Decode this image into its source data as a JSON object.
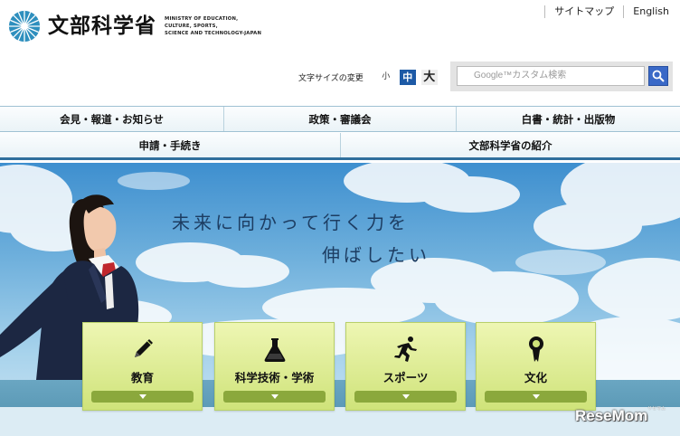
{
  "header": {
    "logo_jp": "文部科学省",
    "logo_en": [
      "MINISTRY OF EDUCATION,",
      "CULTURE, SPORTS,",
      "SCIENCE AND TECHNOLOGY-JAPAN"
    ],
    "top_links": [
      "サイトマップ",
      "English"
    ]
  },
  "font_size": {
    "label": "文字サイズの変更",
    "small": "小",
    "medium": "中",
    "large": "大",
    "selected": "中"
  },
  "search": {
    "placeholder": "Google™カスタム検索"
  },
  "nav": {
    "row1": [
      "会見・報道・お知らせ",
      "政策・審議会",
      "白書・統計・出版物"
    ],
    "row2": [
      "申請・手続き",
      "文部科学省の紹介"
    ]
  },
  "hero": {
    "tagline_line1": "未来に向かって行く力を",
    "tagline_line2": "伸ばしたい"
  },
  "categories": [
    {
      "label": "教育",
      "icon": "pencil-icon"
    },
    {
      "label": "科学技術・学術",
      "icon": "flask-icon"
    },
    {
      "label": "スポーツ",
      "icon": "runner-icon"
    },
    {
      "label": "文化",
      "icon": "medal-icon"
    }
  ],
  "watermark": {
    "text": "ReseMom",
    "sub": "リセマム"
  },
  "colors": {
    "nav_border": "#2f6f9c",
    "selected_fontsize": "#1d5aa6",
    "search_button": "#3a69c7",
    "category_bg": "#dcec94",
    "category_bar": "#8ba83c"
  }
}
